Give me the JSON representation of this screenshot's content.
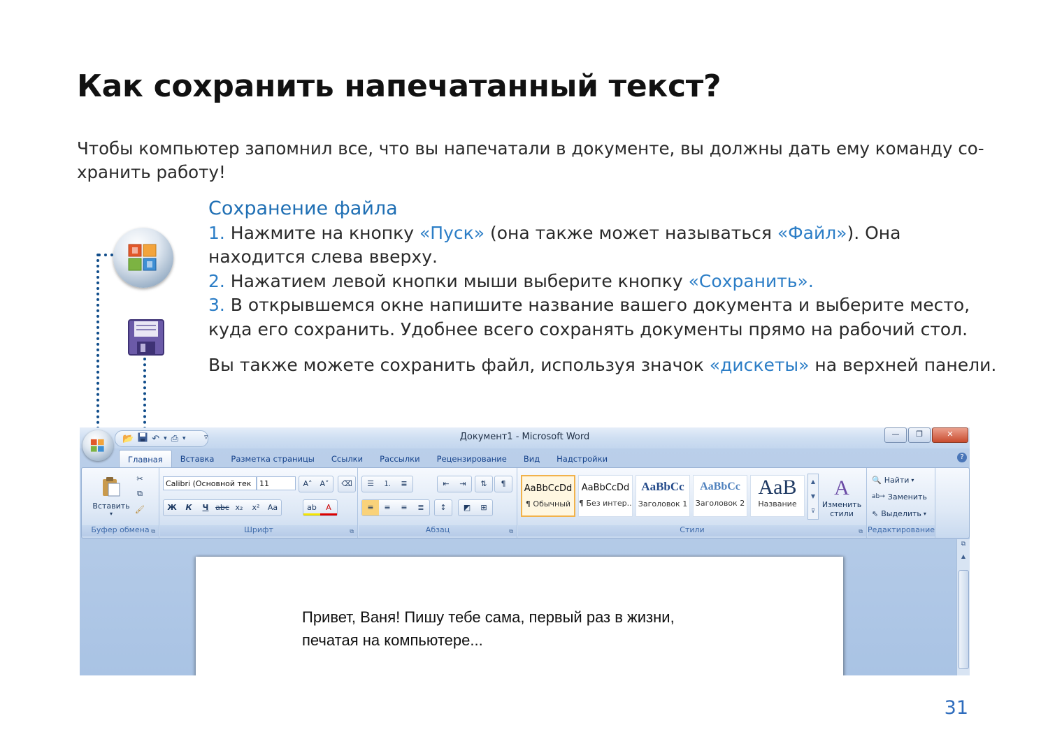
{
  "page": {
    "title": "Как сохранить напечатанный текст?",
    "intro": "Чтобы компьютер запомнил все, что вы напечатали в документе, вы должны дать ему команду со-хранить работу!",
    "page_number": "31"
  },
  "instructions": {
    "section_title": "Сохранение файла",
    "step1": {
      "num": "1.",
      "pre": " Нажмите на кнопку ",
      "accent1": "«Пуск»",
      "mid": " (она также может называться ",
      "accent2": "«Файл»",
      "post": "). Она находится слева вверху."
    },
    "step2": {
      "num": "2.",
      "pre": " Нажатием левой кнопки мыши выберите кнопку ",
      "accent": "«Сохранить»."
    },
    "step3": {
      "num": "3.",
      "text": " В открывшемся окне напишите название вашего документа и выберите место, куда его сохранить. Удобнее всего сохранять документы прямо на рабочий стол."
    },
    "extra": {
      "pre": "Вы также можете сохранить файл, используя значок ",
      "accent": "«дискеты»",
      "post": " на верхней панели."
    }
  },
  "colors": {
    "accent": "#2b7dc6",
    "dots": "#0f4c8a",
    "page_number": "#2e6cbd"
  },
  "icons": [
    "office-button-icon",
    "floppy-disk-icon"
  ],
  "word": {
    "window_title": "Документ1 - Microsoft Word",
    "tabs": [
      "Главная",
      "Вставка",
      "Разметка страницы",
      "Ссылки",
      "Рассылки",
      "Рецензирование",
      "Вид",
      "Надстройки"
    ],
    "active_tab": "Главная",
    "groups": {
      "clipboard": {
        "label": "Буфер обмена",
        "paste": "Вставить"
      },
      "font": {
        "label": "Шрифт",
        "font_name": "Calibri (Основной тек",
        "font_size": "11"
      },
      "paragraph": {
        "label": "Абзац"
      },
      "styles": {
        "label": "Стили",
        "tiles": [
          {
            "sample": "AaBbCcDd",
            "name": "¶ Обычный"
          },
          {
            "sample": "AaBbCcDd",
            "name": "¶ Без интер..."
          },
          {
            "sample": "AaBbCc",
            "name": "Заголовок 1"
          },
          {
            "sample": "AaBbCc",
            "name": "Заголовок 2"
          },
          {
            "sample": "AaB",
            "name": "Название"
          }
        ],
        "change_styles_1": "Изменить",
        "change_styles_2": "стили"
      },
      "editing": {
        "label": "Редактирование",
        "find": "Найти",
        "replace": "Заменить",
        "select": "Выделить"
      }
    },
    "document_text_1": "Привет, Ваня! Пишу тебе сама, первый раз в жизни,",
    "document_text_2": "печатая на компьютере..."
  }
}
